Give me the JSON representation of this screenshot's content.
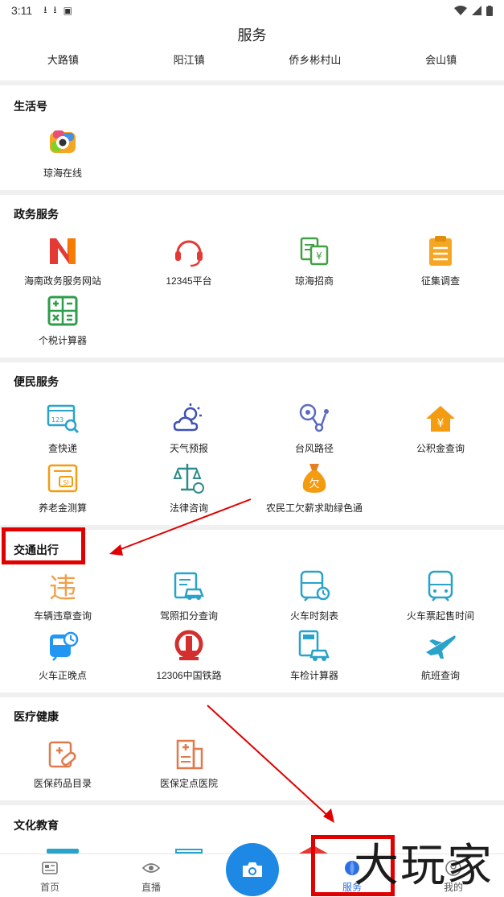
{
  "status_bar": {
    "time": "3:11"
  },
  "header": {
    "title": "服务"
  },
  "towns": [
    "大路镇",
    "阳江镇",
    "侨乡彬村山",
    "会山镇"
  ],
  "sections": {
    "shenghuo": {
      "title": "生活号",
      "items": [
        "琼海在线"
      ]
    },
    "zhengwu": {
      "title": "政务服务",
      "items": [
        "海南政务服务网站",
        "12345平台",
        "琼海招商",
        "征集调查",
        "个税计算器"
      ]
    },
    "bianmin": {
      "title": "便民服务",
      "items": [
        "查快递",
        "天气预报",
        "台风路径",
        "公积金查询",
        "养老金测算",
        "法律咨询",
        "农民工欠薪求助绿色通"
      ]
    },
    "jiaotong": {
      "title": "交通出行",
      "items": [
        "车辆违章查询",
        "驾照扣分查询",
        "火车时刻表",
        "火车票起售时间",
        "火车正晚点",
        "12306中国铁路",
        "车检计算器",
        "航班查询"
      ]
    },
    "yiliao": {
      "title": "医疗健康",
      "items": [
        "医保药品目录",
        "医保定点医院"
      ]
    },
    "wenhua": {
      "title": "文化教育"
    }
  },
  "bottom_nav": {
    "home": "首页",
    "live": "直播",
    "service": "服务",
    "mine": "我的"
  },
  "watermark": "大玩家",
  "colors": {
    "accent": "#2d6fe0",
    "annotation": "#e00000",
    "camera": "#1e88e5"
  }
}
